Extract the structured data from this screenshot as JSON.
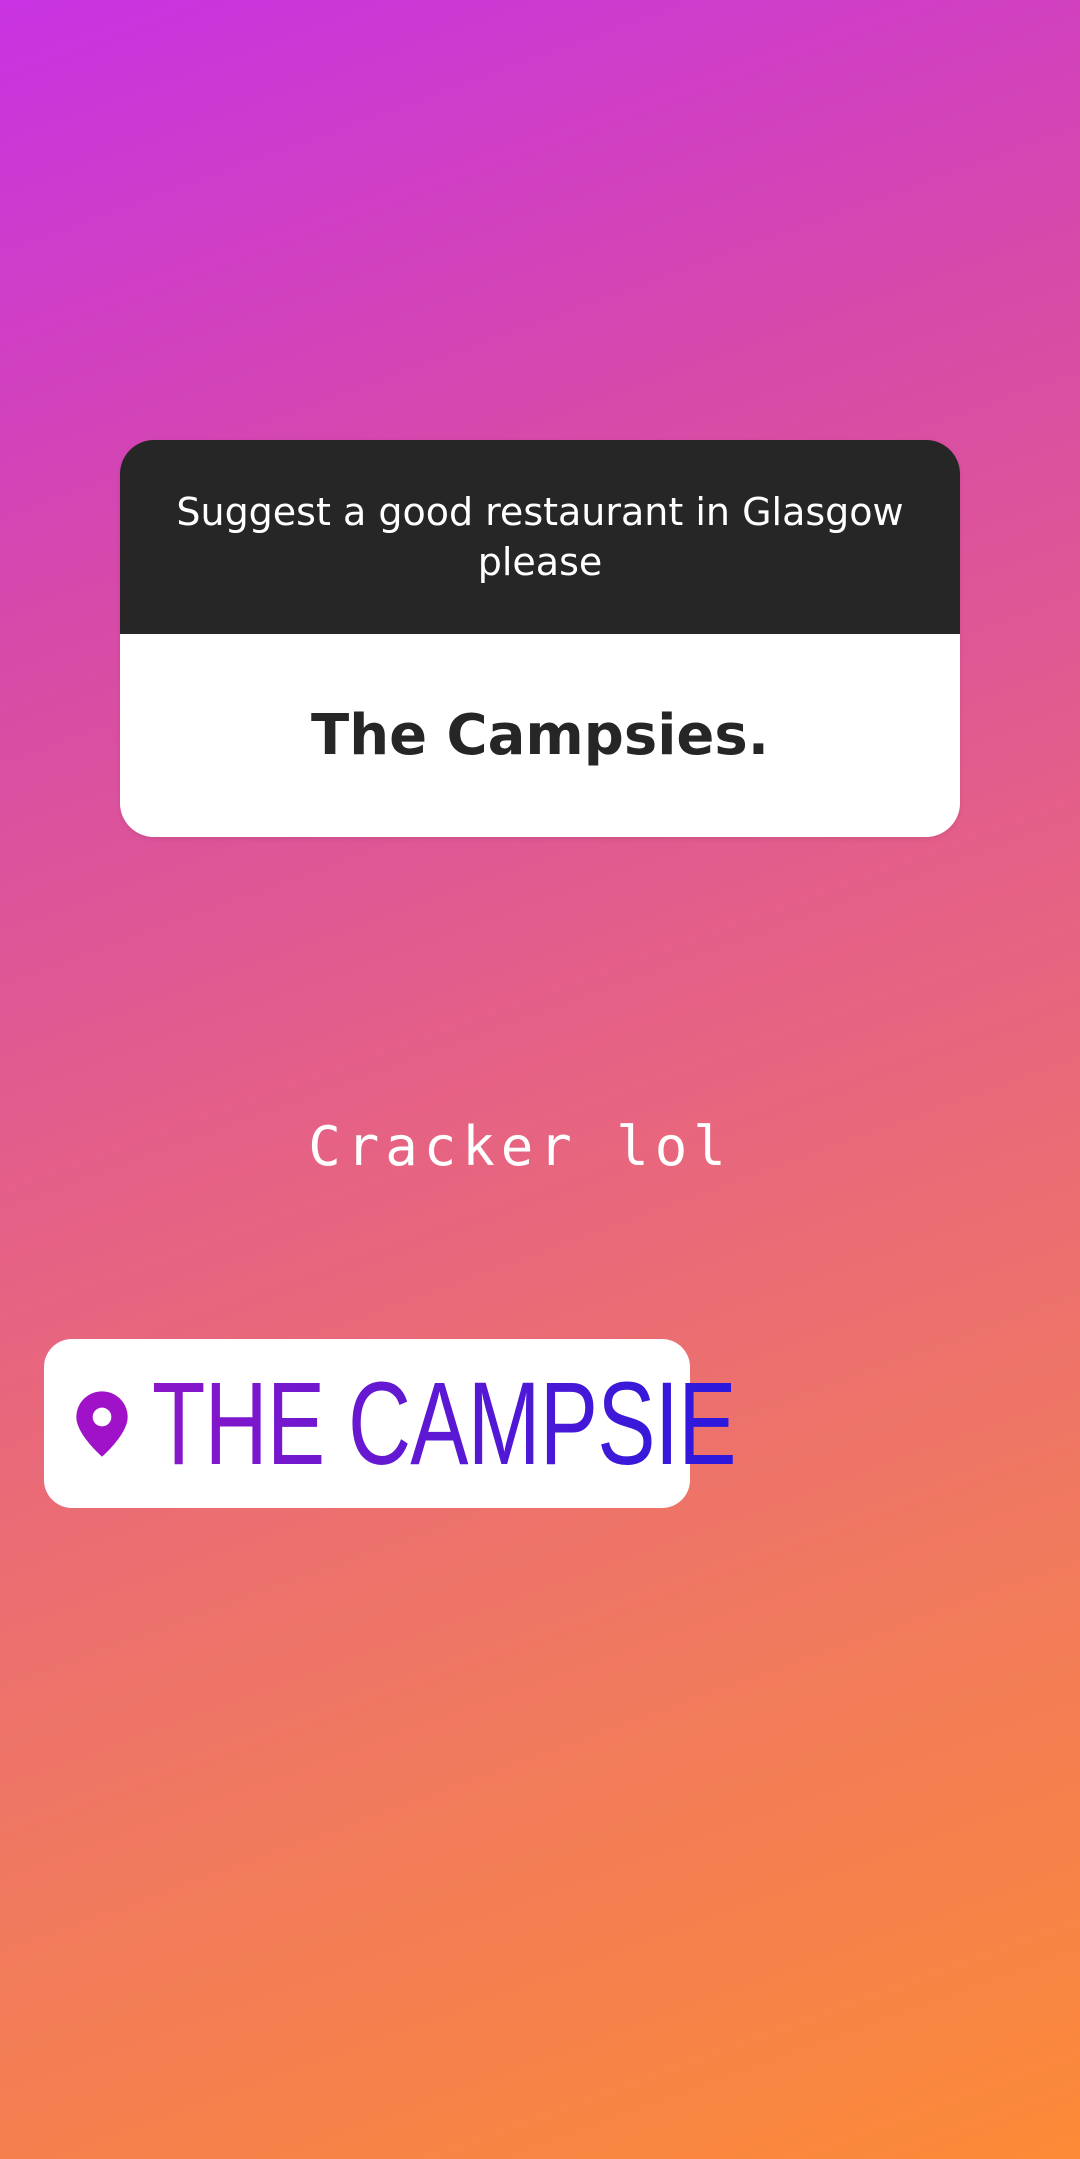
{
  "question_sticker": {
    "question": "Suggest a good restaurant in Glasgow please",
    "answer": "The Campsies."
  },
  "caption": {
    "text": "Cracker lol"
  },
  "location_sticker": {
    "icon": "location-pin-icon",
    "name": "THE CAMPSIE",
    "icon_color": "#a012c8"
  },
  "colors": {
    "gradient_start": "#c832e2",
    "gradient_end": "#fc8a36",
    "question_header_bg": "#262626",
    "answer_bg": "#ffffff"
  }
}
